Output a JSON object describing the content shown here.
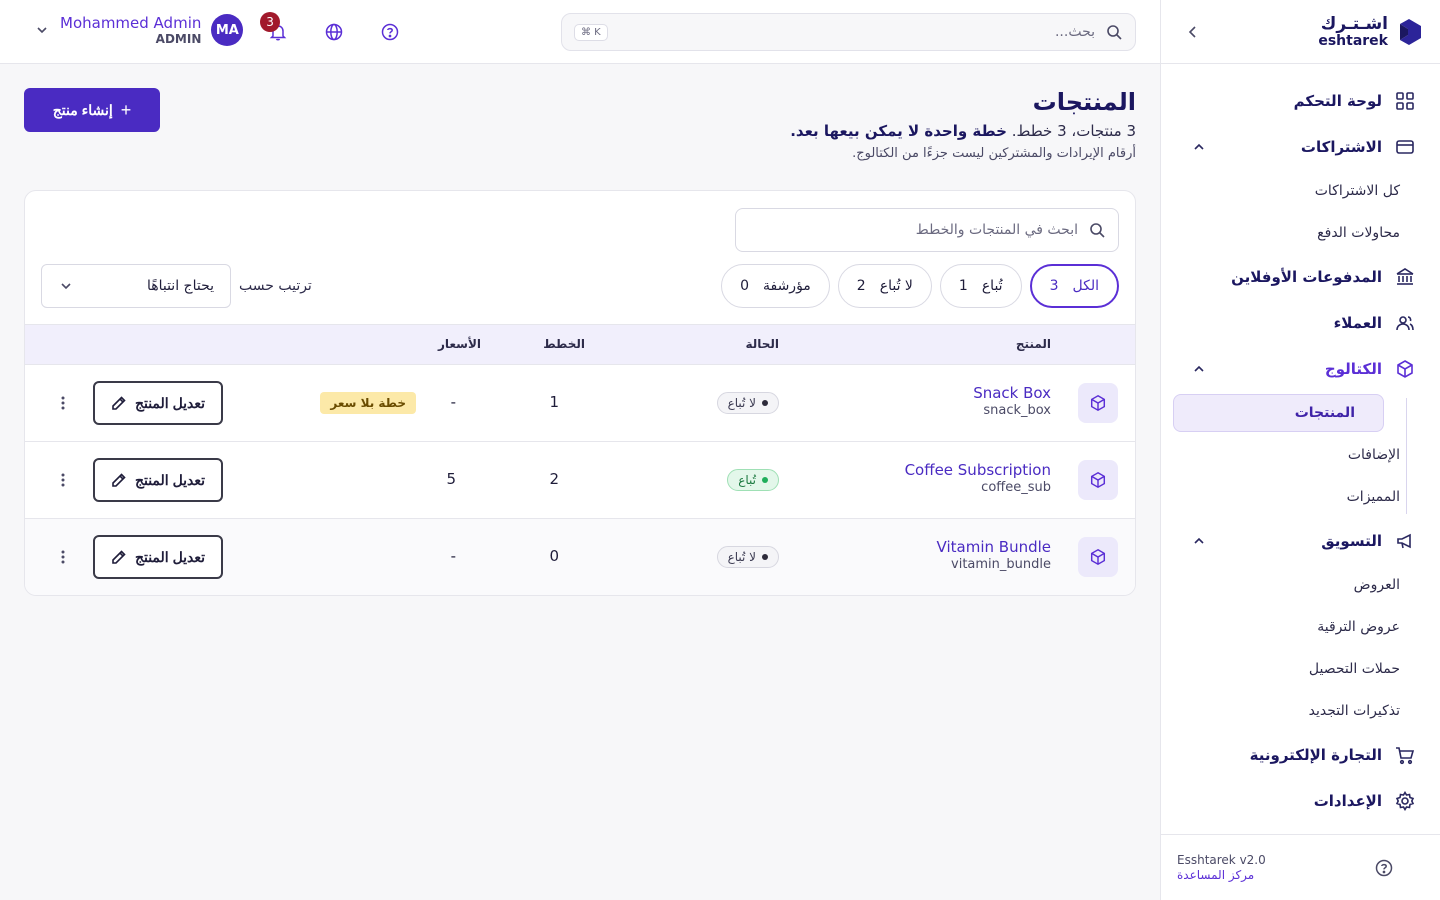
{
  "brand": {
    "name_ar": "اشـتـرك",
    "name_en": "eshtarek"
  },
  "sidebar": {
    "items": [
      {
        "label": "لوحة التحكم",
        "icon": "dashboard-icon"
      },
      {
        "label": "الاشتراكات",
        "icon": "card-icon",
        "expanded": true,
        "children": [
          {
            "label": "كل الاشتراكات"
          },
          {
            "label": "محاولات الدفع"
          }
        ]
      },
      {
        "label": "المدفوعات الأوفلاين",
        "icon": "bank-icon"
      },
      {
        "label": "العملاء",
        "icon": "users-icon"
      },
      {
        "label": "الكتالوج",
        "icon": "package-icon",
        "expanded": true,
        "active": true,
        "children": [
          {
            "label": "المنتجات",
            "active": true
          },
          {
            "label": "الإضافات"
          },
          {
            "label": "المميزات"
          }
        ]
      },
      {
        "label": "التسويق",
        "icon": "megaphone-icon",
        "expanded": true,
        "children": [
          {
            "label": "العروض"
          },
          {
            "label": "عروض الترقية"
          },
          {
            "label": "حملات التحصيل"
          },
          {
            "label": "تذكيرات التجديد"
          }
        ]
      },
      {
        "label": "التجارة الإلكترونية",
        "icon": "cart-icon"
      },
      {
        "label": "الإعدادات",
        "icon": "gear-icon"
      }
    ],
    "footer": {
      "version": "Esshtarek v2.0",
      "help_link": "مركز المساعدة"
    }
  },
  "topbar": {
    "search_placeholder": "بحث...",
    "shortcut": "⌘ K",
    "notification_count": "3",
    "user": {
      "name": "Mohammed Admin",
      "role": "ADMIN",
      "initials": "MA"
    }
  },
  "page": {
    "title": "المنتجات",
    "summary_plain": "3 منتجات، 3 خطط. ",
    "summary_bold": "خطة واحدة لا يمكن بيعها بعد.",
    "note": "أرقام الإيرادات والمشتركين ليست جزءًا من الكتالوج.",
    "create_label": "إنشاء منتج"
  },
  "filters": {
    "search_placeholder": "ابحث في المنتجات والخطط",
    "chips": [
      {
        "label": "الكل",
        "count": "3",
        "active": true
      },
      {
        "label": "تُباع",
        "count": "1"
      },
      {
        "label": "لا تُباع",
        "count": "2"
      },
      {
        "label": "مؤرشفة",
        "count": "0"
      }
    ],
    "sort_label": "ترتيب حسب",
    "sort_value": "يحتاج انتباهًا"
  },
  "table": {
    "headers": {
      "product": "المنتج",
      "status": "الحالة",
      "plans": "الخطط",
      "prices": "الأسعار"
    },
    "edit_label": "تعديل المنتج",
    "rows": [
      {
        "name": "Snack Box",
        "code": "snack_box",
        "status": "لا تُباع",
        "sold": false,
        "plans": "1",
        "prices": "-",
        "warning": "خطة بلا سعر"
      },
      {
        "name": "Coffee Subscription",
        "code": "coffee_sub",
        "status": "تُباع",
        "sold": true,
        "plans": "2",
        "prices": "5",
        "warning": ""
      },
      {
        "name": "Vitamin Bundle",
        "code": "vitamin_bundle",
        "status": "لا تُباع",
        "sold": false,
        "plans": "0",
        "prices": "-",
        "warning": ""
      }
    ]
  },
  "colors": {
    "primary": "#4a2bc2",
    "accent": "#5b2fd6",
    "navy": "#1b1760",
    "danger_badge": "#a1192b",
    "warn_bg": "#fce9a8",
    "success": "#1fae5b"
  }
}
